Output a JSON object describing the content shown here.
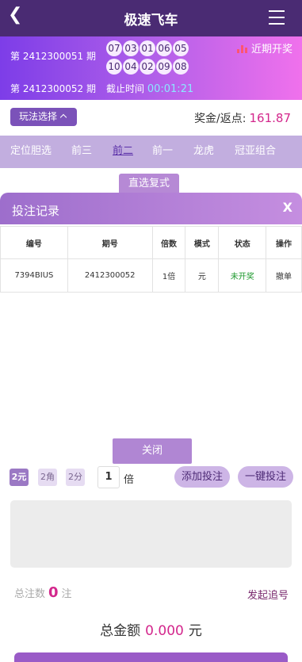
{
  "header": {
    "title": "极速飞车",
    "back_icon": "chevron-left-icon",
    "menu_icon": "hamburger-icon"
  },
  "banner": {
    "period_current": "第 2412300051 期",
    "period_next": "第 2412300052 期",
    "balls": [
      "07",
      "03",
      "01",
      "06",
      "05",
      "10",
      "04",
      "02",
      "09",
      "08"
    ],
    "recent_label": "近期开奖",
    "deadline_label": "截止时间",
    "deadline_time": "00:01:21"
  },
  "mode": {
    "button_label": "玩法选择",
    "prize_label": "奖金/返点:",
    "prize_value": "161.87"
  },
  "tabs": [
    "定位胆选",
    "前三",
    "前二",
    "前一",
    "龙虎",
    "冠亚组合"
  ],
  "active_tab": 2,
  "subtab": "直选复式",
  "modal": {
    "title": "投注记录",
    "close_x": "X",
    "columns": [
      "编号",
      "期号",
      "倍数",
      "模式",
      "状态",
      "操作"
    ],
    "rows": [
      {
        "id": "7394BIUS",
        "period": "2412300052",
        "multiple": "1倍",
        "mode": "元",
        "status": "未开奖",
        "action": "撤单"
      }
    ],
    "close_button": "关闭"
  },
  "units": [
    "2元",
    "2角",
    "2分"
  ],
  "multiple": {
    "value": "1",
    "label": "倍"
  },
  "buttons": {
    "add": "添加投注",
    "one_click": "一键投注"
  },
  "summary": {
    "count_label": "总注数",
    "count_value": "0",
    "count_unit": "注",
    "follow_label": "发起追号",
    "total_label": "总金额",
    "total_value": "0.000",
    "total_unit": "元"
  },
  "colors": {
    "header": "#4a2b73",
    "accent": "#7b52b9",
    "highlight": "#d3278c",
    "status_open": "#1f9a2f"
  }
}
